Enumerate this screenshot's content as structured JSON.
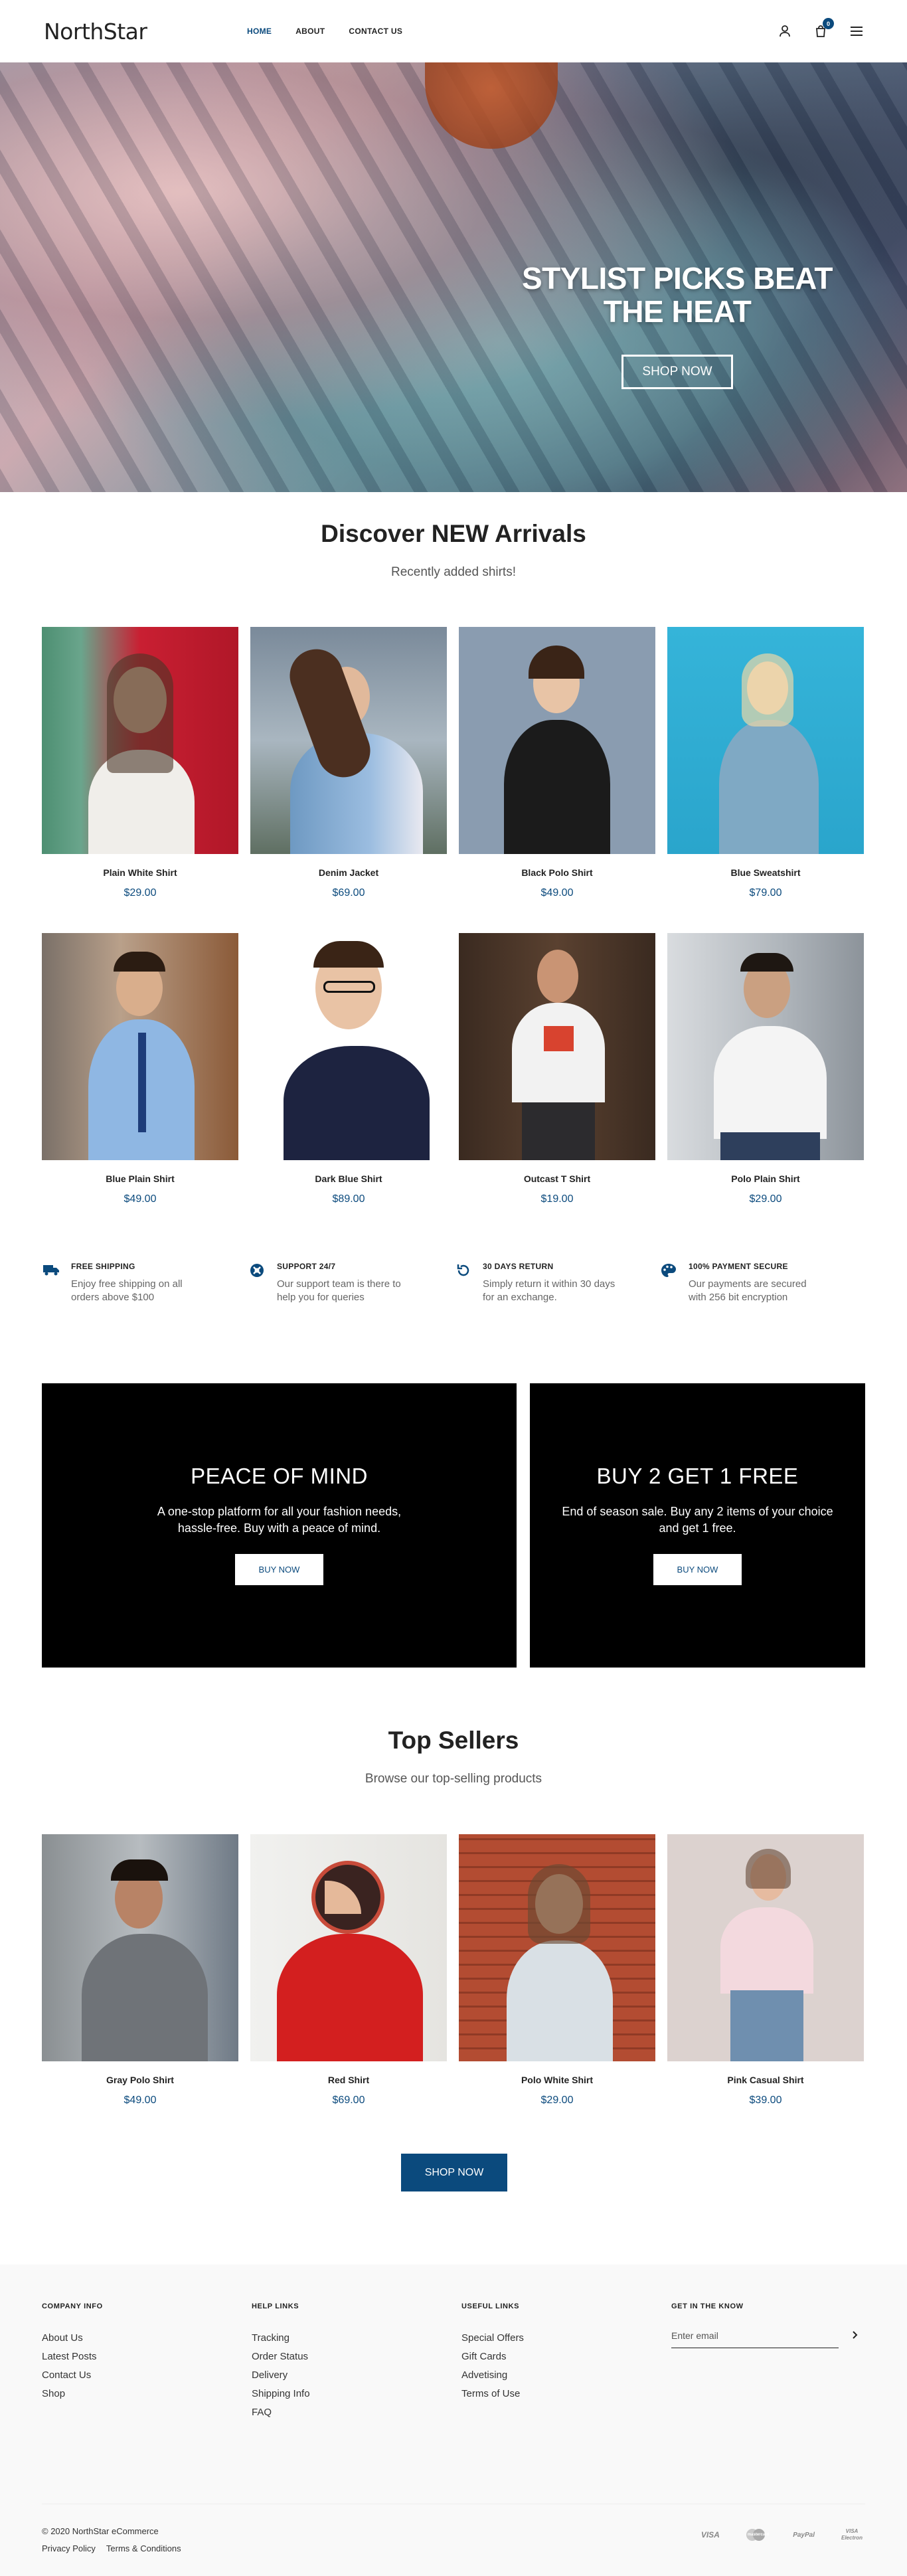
{
  "brand": {
    "logo": "NorthStar"
  },
  "nav": {
    "items": [
      "HOME",
      "ABOUT",
      "CONTACT US"
    ]
  },
  "header": {
    "cart_count": "0"
  },
  "hero": {
    "title_line1": "STYLIST PICKS BEAT",
    "title_line2": "THE HEAT",
    "cta": "SHOP NOW"
  },
  "new_arrivals": {
    "title": "Discover NEW Arrivals",
    "subtitle": "Recently added shirts!",
    "products": [
      {
        "name": "Plain White Shirt",
        "price": "$29.00"
      },
      {
        "name": "Denim Jacket",
        "price": "$69.00"
      },
      {
        "name": "Black Polo Shirt",
        "price": "$49.00"
      },
      {
        "name": "Blue Sweatshirt",
        "price": "$79.00"
      },
      {
        "name": "Blue Plain Shirt",
        "price": "$49.00"
      },
      {
        "name": "Dark Blue Shirt",
        "price": "$89.00"
      },
      {
        "name": "Outcast T Shirt",
        "price": "$19.00"
      },
      {
        "name": "Polo Plain Shirt",
        "price": "$29.00"
      }
    ]
  },
  "features": [
    {
      "icon": "truck-icon",
      "title": "FREE SHIPPING",
      "desc": "Enjoy free shipping on all orders above $100"
    },
    {
      "icon": "support-icon",
      "title": "SUPPORT 24/7",
      "desc": "Our support team is there to help you for queries"
    },
    {
      "icon": "return-icon",
      "title": "30 DAYS RETURN",
      "desc": "Simply return it within 30 days for an exchange."
    },
    {
      "icon": "palette-icon",
      "title": "100% PAYMENT SECURE",
      "desc": "Our payments are secured with 256 bit encryption"
    }
  ],
  "promos": [
    {
      "title": "PEACE OF MIND",
      "desc": "A one-stop platform for all your fashion needs, hassle-free. Buy with a peace of mind.",
      "cta": "BUY NOW"
    },
    {
      "title": "BUY 2 GET 1 FREE",
      "desc": "End of season sale. Buy any 2 items of your choice and get 1 free.",
      "cta": "BUY NOW"
    }
  ],
  "top_sellers": {
    "title": "Top Sellers",
    "subtitle": "Browse our top-selling products",
    "products": [
      {
        "name": "Gray Polo Shirt",
        "price": "$49.00"
      },
      {
        "name": "Red Shirt",
        "price": "$69.00"
      },
      {
        "name": "Polo White Shirt",
        "price": "$29.00"
      },
      {
        "name": "Pink Casual Shirt",
        "price": "$39.00"
      }
    ],
    "cta": "SHOP NOW"
  },
  "footer": {
    "company_info": {
      "title": "COMPANY INFO",
      "links": [
        "About Us",
        "Latest Posts",
        "Contact Us",
        "Shop"
      ]
    },
    "help_links": {
      "title": "HELP LINKS",
      "links": [
        "Tracking",
        "Order Status",
        "Delivery",
        "Shipping Info",
        "FAQ"
      ]
    },
    "useful_links": {
      "title": "USEFUL LINKS",
      "links": [
        "Special Offers",
        "Gift Cards",
        "Advetising",
        "Terms of Use"
      ]
    },
    "newsletter": {
      "title": "GET IN THE KNOW",
      "placeholder": "Enter email"
    },
    "copyright": "© 2020 NorthStar eCommerce",
    "legal": [
      "Privacy Policy",
      "Terms & Conditions"
    ],
    "payments": [
      "VISA",
      "mastercard",
      "PayPal",
      "VISA Electron"
    ]
  },
  "colors": {
    "accent": "#0b4a7d",
    "promo_bg": "#000000",
    "footer_bg": "#f9f9f9"
  }
}
